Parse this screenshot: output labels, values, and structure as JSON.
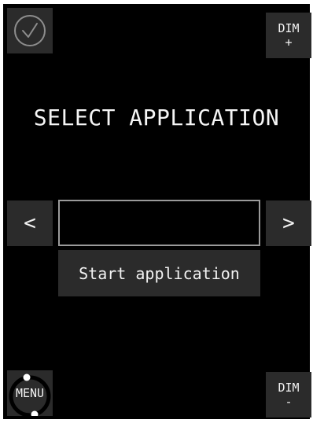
{
  "screen": {
    "title": "SELECT APPLICATION",
    "background": "#000000",
    "tile_color": "#2b2b2b",
    "text_color": "#f2f2f2"
  },
  "confirm": {
    "icon": "check-circle-icon"
  },
  "dim_up": {
    "label": "DIM",
    "symbol": "+"
  },
  "dim_down": {
    "label": "DIM",
    "symbol": "-"
  },
  "selector": {
    "prev_label": "<",
    "next_label": ">",
    "current_app": ""
  },
  "start": {
    "label": "Start application"
  },
  "menu": {
    "label": "MENU",
    "icon": "menu-ring-icon"
  }
}
